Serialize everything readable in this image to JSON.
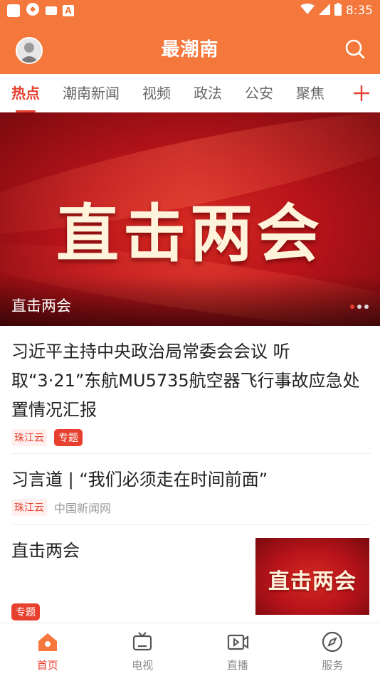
{
  "status": {
    "time": "8:35"
  },
  "header": {
    "title": "最潮南"
  },
  "tabs": [
    {
      "label": "热点",
      "active": true
    },
    {
      "label": "潮南新闻",
      "active": false
    },
    {
      "label": "视频",
      "active": false
    },
    {
      "label": "政法",
      "active": false
    },
    {
      "label": "公安",
      "active": false
    },
    {
      "label": "聚焦",
      "active": false
    }
  ],
  "banner": {
    "headline": "直击两会",
    "caption": "直击两会",
    "slide_count": 3,
    "active_slide": 1
  },
  "feed": [
    {
      "title": "习近平主持中央政治局常委会会议 听取“3·21”东航MU5735航空器飞行事故应急处置情况汇报",
      "source": "珠江云",
      "special": "专题"
    },
    {
      "title": "习言道 | “我们必须走在时间前面”",
      "source": "珠江云",
      "origin": "中国新闻网"
    },
    {
      "title": "直击两会",
      "special": "专题",
      "thumb_text": "直击两会"
    }
  ],
  "nav": [
    {
      "label": "首页",
      "icon": "home-icon",
      "active": true
    },
    {
      "label": "电视",
      "icon": "tv-icon",
      "active": false
    },
    {
      "label": "直播",
      "icon": "live-icon",
      "active": false
    },
    {
      "label": "服务",
      "icon": "compass-icon",
      "active": false
    }
  ],
  "colors": {
    "brand": "#f4773b",
    "accent": "#e8402f"
  }
}
